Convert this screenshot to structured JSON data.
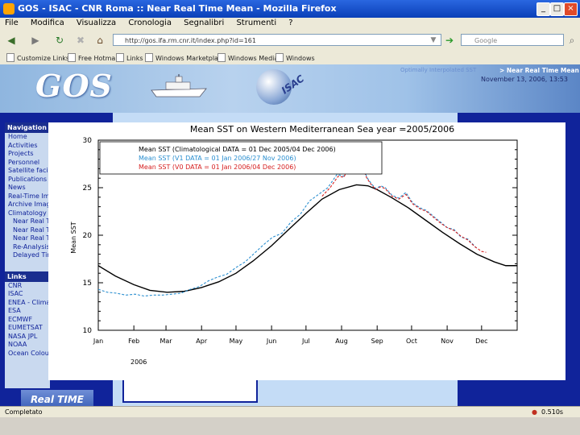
{
  "window": {
    "title": "GOS - ISAC - CNR Roma :: Near Real Time Mean - Mozilla Firefox",
    "min": "_",
    "max": "□",
    "close": "×"
  },
  "menu": [
    "File",
    "Modifica",
    "Visualizza",
    "Cronologia",
    "Segnalibri",
    "Strumenti",
    "?"
  ],
  "nav": {
    "url": "http://gos.ifa.rm.cnr.it/index.php?id=161",
    "search_placeholder": "Google"
  },
  "bookmarks": [
    "Customize Links",
    "Free Hotmail",
    "Links",
    "Windows Marketplace",
    "Windows Media",
    "Windows"
  ],
  "banner": {
    "logo": "GOS",
    "globe_text": "ISAC",
    "section_link": "Optimally Interpolated SST",
    "section_title": "> Near Real Time Mean",
    "date": "November 13, 2006, 13:53"
  },
  "sidebar": {
    "nav_heading": "Navigation",
    "nav_items": [
      "Home",
      "Activities",
      "Projects",
      "Personnel",
      "Satellite facilities",
      "Publications",
      "News",
      "Real-Time Images",
      "Archive Images",
      "Climatology"
    ],
    "sub_items": [
      "Near Real Time",
      "Near Real Time",
      "Near Real Time",
      "Re-Analysis",
      "Delayed Time"
    ],
    "links_heading": "Links",
    "link_items": [
      "CNR",
      "ISAC",
      "ENEA - Climate",
      "ESA",
      "ECMWF",
      "EUMETSAT",
      "NASA JPL",
      "NOAA",
      "Ocean Colour"
    ]
  },
  "promo": "Real TIME HERE!",
  "status": {
    "text": "Completato",
    "right": "0.510s"
  },
  "colors": {
    "climatology": "#000000",
    "series_2006": "#2b8fd0",
    "series_2006_red": "#d62020"
  },
  "chart_data": {
    "type": "line",
    "title": "Mean SST on Western Mediterranean Sea      year =2005/2006",
    "ylabel": "Mean SST",
    "xlabel": "2006",
    "ylim": [
      10,
      30
    ],
    "yticks": [
      10,
      15,
      20,
      25,
      30
    ],
    "x_axis_range_days": [
      0,
      365
    ],
    "month_labels": [
      "Jan",
      "Feb",
      "Mar",
      "Apr",
      "May",
      "Jun",
      "Jul",
      "Aug",
      "Sep",
      "Oct",
      "Nov",
      "Dec"
    ],
    "month_day_of_year": [
      0,
      31,
      59,
      90,
      120,
      151,
      181,
      212,
      243,
      273,
      304,
      334
    ],
    "legend_position": "top-left",
    "series": [
      {
        "name": "Mean SST (Climatological DATA = 01 Dec 2005/04 Dec 2006)",
        "color": "#000000",
        "style": "solid",
        "x": [
          0,
          15,
          31,
          45,
          60,
          75,
          90,
          105,
          120,
          135,
          151,
          165,
          181,
          195,
          210,
          225,
          235,
          243,
          255,
          270,
          285,
          300,
          315,
          330,
          345,
          355,
          365
        ],
        "y": [
          16.8,
          15.7,
          14.8,
          14.2,
          14.0,
          14.1,
          14.5,
          15.1,
          16.0,
          17.3,
          18.9,
          20.5,
          22.3,
          23.8,
          24.8,
          25.3,
          25.2,
          24.8,
          24.0,
          22.9,
          21.6,
          20.3,
          19.1,
          18.0,
          17.2,
          16.8,
          16.8
        ]
      },
      {
        "name": "Mean SST (V1 DATA = 01 Jan 2006/27 Nov 2006)",
        "color": "#2b8fd0",
        "style": "dashed",
        "x": [
          0,
          8,
          16,
          24,
          32,
          40,
          48,
          56,
          64,
          72,
          80,
          88,
          96,
          104,
          112,
          120,
          128,
          136,
          144,
          152,
          160,
          168,
          176,
          184,
          192,
          200,
          208,
          214,
          218,
          222,
          226,
          230,
          234,
          238,
          242,
          246,
          250,
          256,
          262,
          268,
          274,
          280,
          286,
          292,
          298,
          304,
          310,
          316,
          322,
          330
        ],
        "y": [
          14.3,
          14.0,
          13.9,
          13.7,
          13.8,
          13.6,
          13.7,
          13.7,
          13.8,
          13.9,
          14.3,
          14.6,
          15.2,
          15.6,
          15.9,
          16.6,
          17.2,
          18.1,
          19.0,
          19.8,
          20.2,
          21.4,
          22.2,
          23.6,
          24.3,
          25.0,
          26.4,
          26.2,
          27.2,
          27.7,
          27.9,
          27.5,
          26.1,
          25.4,
          24.9,
          25.2,
          25.0,
          24.2,
          23.9,
          24.5,
          23.4,
          22.9,
          22.6,
          22.0,
          21.4,
          20.8,
          20.6,
          19.8,
          19.6,
          18.6
        ]
      },
      {
        "name": "Mean SST (V0 DATA = 01 Jan 2006/04 Dec 2006)",
        "color": "#d62020",
        "style": "dashed",
        "x": [
          195,
          202,
          209,
          214,
          218,
          222,
          226,
          230,
          234,
          238,
          242,
          246,
          250,
          256,
          262,
          268,
          274,
          280,
          286,
          292,
          298,
          304,
          310,
          316,
          322,
          328,
          334,
          338
        ],
        "y": [
          24.1,
          25.0,
          26.2,
          26.1,
          27.1,
          27.6,
          27.9,
          27.3,
          26.0,
          25.3,
          24.8,
          25.1,
          24.9,
          24.1,
          23.8,
          24.3,
          23.3,
          22.8,
          22.5,
          21.9,
          21.3,
          20.8,
          20.5,
          19.9,
          19.5,
          18.8,
          18.3,
          18.2
        ]
      }
    ]
  }
}
